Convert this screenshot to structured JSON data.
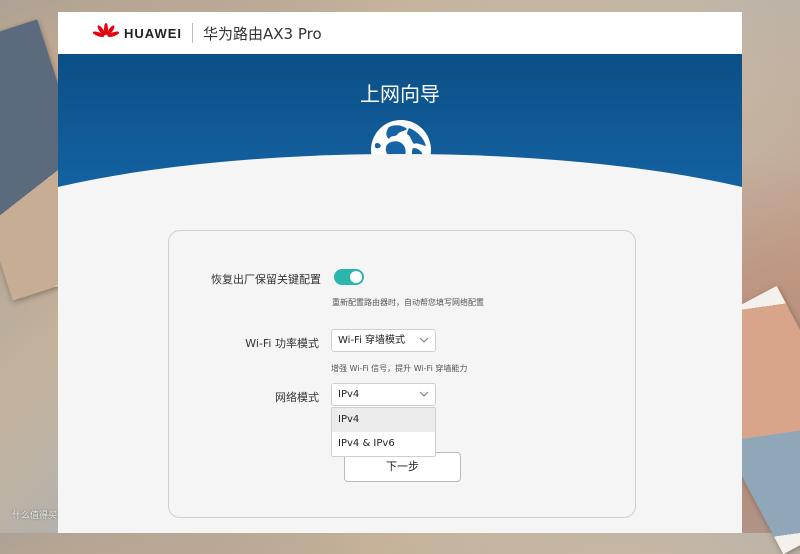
{
  "header": {
    "brand": "HUAWEI",
    "product": "华为路由AX3 Pro",
    "logo_icon": "huawei-logo-icon",
    "brand_color": "#e60012"
  },
  "banner": {
    "title": "上网向导",
    "icon": "globe-icon",
    "color": "#0b4f86"
  },
  "form": {
    "restore_label": "恢复出厂保留关键配置",
    "restore_toggle_on": true,
    "restore_hint": "重新配置路由器时，自动帮您填写网络配置",
    "wifi_mode_label": "Wi-Fi 功率模式",
    "wifi_mode_value": "Wi-Fi 穿墙模式",
    "wifi_mode_hint": "增强 Wi-Fi 信号，提升 Wi-Fi 穿墙能力",
    "network_mode_label": "网络模式",
    "network_mode_value": "IPv4",
    "network_mode_options": [
      "IPv4",
      "IPv4 & IPv6"
    ],
    "next_button": "下一步",
    "accent_color": "#2bb6ac"
  },
  "watermark": "什么值得买"
}
